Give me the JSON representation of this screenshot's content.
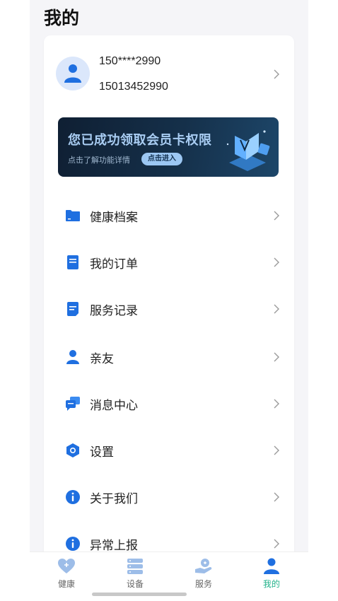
{
  "header": {
    "title": "我的"
  },
  "profile": {
    "phone_masked": "150****2990",
    "phone_full": "15013452990",
    "avatar_icon": "user-icon"
  },
  "banner": {
    "title": "您已成功领取会员卡权限",
    "subtitle": "点击了解功能详情",
    "button_label": "点击进入"
  },
  "menu": {
    "items": [
      {
        "label": "健康档案",
        "icon": "folder-icon"
      },
      {
        "label": "我的订单",
        "icon": "order-icon"
      },
      {
        "label": "服务记录",
        "icon": "record-icon"
      },
      {
        "label": "亲友",
        "icon": "person-icon"
      },
      {
        "label": "消息中心",
        "icon": "message-icon"
      },
      {
        "label": "设置",
        "icon": "settings-icon"
      },
      {
        "label": "关于我们",
        "icon": "info-icon"
      },
      {
        "label": "异常上报",
        "icon": "info-icon"
      }
    ]
  },
  "tabbar": {
    "tabs": [
      {
        "label": "健康",
        "icon": "heart-icon",
        "active": false
      },
      {
        "label": "设备",
        "icon": "device-icon",
        "active": false
      },
      {
        "label": "服务",
        "icon": "service-icon",
        "active": false
      },
      {
        "label": "我的",
        "icon": "profile-icon",
        "active": true
      }
    ]
  },
  "colors": {
    "accent_blue": "#1f6fe0",
    "active_tab": "#21b28a",
    "banner_bg": "#15304a",
    "banner_text": "#a9cdf3"
  }
}
